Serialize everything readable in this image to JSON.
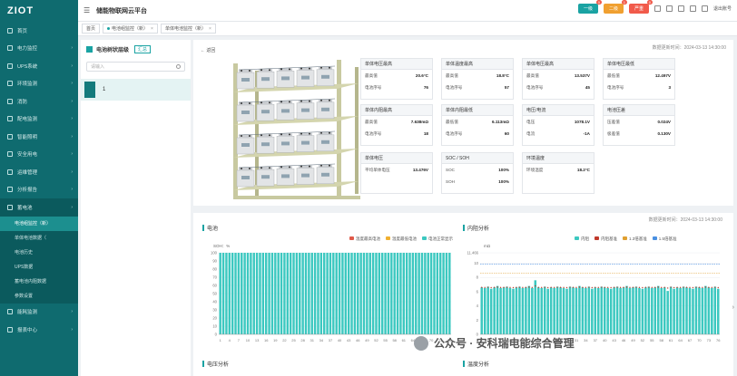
{
  "app": {
    "logo": "ZIOT",
    "title": "储能物联网云平台"
  },
  "header": {
    "badges": [
      {
        "label": "一级",
        "count": "0",
        "color": "#1aa3a3"
      },
      {
        "label": "二级",
        "count": "1",
        "color": "#f0a030"
      },
      {
        "label": "严重",
        "count": "0",
        "color": "#f15a4a"
      }
    ],
    "user": "退出账号"
  },
  "sidebar": {
    "items": [
      {
        "label": "首页"
      },
      {
        "label": "电力监控"
      },
      {
        "label": "UPS系统"
      },
      {
        "label": "环境监测"
      },
      {
        "label": "消防"
      },
      {
        "label": "配电监测"
      },
      {
        "label": "智能照明"
      },
      {
        "label": "安全用电"
      },
      {
        "label": "运维管理"
      },
      {
        "label": "分析报告"
      },
      {
        "label": "蓄电池"
      }
    ],
    "subitems": [
      {
        "label": "电池组监控（新）"
      },
      {
        "label": "单体电池数据（"
      },
      {
        "label": "电池历史"
      },
      {
        "label": "UPS数据"
      },
      {
        "label": "蓄电池内阻数据"
      },
      {
        "label": "参数设置"
      }
    ],
    "bottom": [
      {
        "label": "能耗监测"
      },
      {
        "label": "报表中心"
      }
    ]
  },
  "tabs": [
    {
      "label": "首页"
    },
    {
      "label": "电池组监控（新）"
    },
    {
      "label": "单体电池监控（新）"
    }
  ],
  "tree": {
    "title": "电池树状层级",
    "badge": "汇总",
    "search_placeholder": "请输入",
    "node": "1"
  },
  "main": {
    "back": "返回",
    "update": "数据更新时间：2024-03-13 14:30:00",
    "cards": [
      {
        "title": "单体电压最高",
        "rows": [
          {
            "k": "最高值",
            "v": "20.6°C"
          },
          {
            "k": "电池序号",
            "v": "76"
          }
        ]
      },
      {
        "title": "单体温度最高",
        "rows": [
          {
            "k": "最高值",
            "v": "18.8°C"
          },
          {
            "k": "电池序号",
            "v": "57"
          }
        ]
      },
      {
        "title": "单体电压最高",
        "rows": [
          {
            "k": "最高值",
            "v": "13.537V"
          },
          {
            "k": "电池序号",
            "v": "45"
          }
        ]
      },
      {
        "title": "单体电压最低",
        "rows": [
          {
            "k": "最低值",
            "v": "12.497V"
          },
          {
            "k": "电池序号",
            "v": "3"
          }
        ]
      },
      {
        "title": "单体内阻最高",
        "rows": [
          {
            "k": "最高值",
            "v": "7.638mΩ"
          },
          {
            "k": "电池序号",
            "v": "18"
          }
        ]
      },
      {
        "title": "单体内阻最低",
        "rows": [
          {
            "k": "最低值",
            "v": "6.113mΩ"
          },
          {
            "k": "电池序号",
            "v": "60"
          }
        ]
      },
      {
        "title": "电压/电流",
        "rows": [
          {
            "k": "电压",
            "v": "1078.1V"
          },
          {
            "k": "电流",
            "v": "-1A"
          }
        ]
      },
      {
        "title": "电池压差",
        "rows": [
          {
            "k": "压差值",
            "v": "0.024V"
          },
          {
            "k": "极差值",
            "v": "0.130V"
          }
        ]
      },
      {
        "title": "单体电压",
        "rows": [
          {
            "k": "平均单体电压",
            "v": "13.476V"
          }
        ]
      },
      {
        "title": "SOC / SOH",
        "rows": [
          {
            "k": "SOC",
            "v": "100%"
          },
          {
            "k": "SOH",
            "v": "100%"
          }
        ]
      },
      {
        "title": "环境温度",
        "rows": [
          {
            "k": "环境温度",
            "v": "18.2°C"
          }
        ]
      }
    ]
  },
  "charts_header": {
    "report_time": "数据更新时间：2024-03-13 14:30:00"
  },
  "chart_data": [
    {
      "type": "bar",
      "title": "电池",
      "ylabel": "SOH：%",
      "ylim": [
        0,
        100
      ],
      "yticks": [
        0,
        10,
        20,
        30,
        40,
        50,
        60,
        70,
        80,
        90,
        100
      ],
      "legend": [
        {
          "name": "温度最高电池",
          "color": "#e05a4a"
        },
        {
          "name": "温度最低电池",
          "color": "#f0b030"
        },
        {
          "name": "电池正常显示",
          "color": "#3cc8c0"
        }
      ],
      "categories_count": 76,
      "xticks": [
        "1",
        "4",
        "7",
        "10",
        "13",
        "16",
        "19",
        "22",
        "25",
        "28",
        "31",
        "34",
        "37",
        "40",
        "43",
        "46",
        "49",
        "52",
        "55",
        "58",
        "61",
        "64",
        "67",
        "70",
        "73",
        "76"
      ],
      "values": [
        100,
        100,
        100,
        100,
        100,
        100,
        100,
        100,
        100,
        100,
        100,
        100,
        100,
        100,
        100,
        100,
        100,
        100,
        100,
        100,
        100,
        100,
        100,
        100,
        100,
        100,
        100,
        100,
        100,
        100,
        100,
        100,
        100,
        100,
        100,
        100,
        100,
        100,
        100,
        100,
        100,
        100,
        100,
        100,
        100,
        100,
        100,
        100,
        100,
        100,
        100,
        100,
        100,
        100,
        100,
        100,
        100,
        100,
        100,
        100,
        100,
        100,
        100,
        100,
        100,
        100,
        100,
        100,
        100,
        100,
        100,
        100,
        100,
        100,
        100,
        100
      ]
    },
    {
      "type": "bar",
      "title": "内阻分析",
      "ylabel": "mΩ",
      "ylim": [
        0,
        11.466
      ],
      "yticks": [
        0,
        2,
        4,
        6,
        8,
        10,
        11.466
      ],
      "legend": [
        {
          "name": "内阻",
          "color": "#3cc8c0"
        },
        {
          "name": "内阻基准",
          "color": "#c0392b"
        },
        {
          "name": "1.3倍基准",
          "color": "#e0a030"
        },
        {
          "name": "1.5倍基准",
          "color": "#4a90e2"
        }
      ],
      "categories_count": 76,
      "xticks": [
        "1",
        "4",
        "7",
        "10",
        "13",
        "16",
        "19",
        "22",
        "25",
        "28",
        "31",
        "34",
        "37",
        "40",
        "43",
        "46",
        "49",
        "52",
        "55",
        "58",
        "61",
        "64",
        "67",
        "70",
        "73",
        "76"
      ],
      "values": [
        6.6,
        6.5,
        6.7,
        6.4,
        6.6,
        6.8,
        6.5,
        6.6,
        6.7,
        6.5,
        6.4,
        6.6,
        6.7,
        6.5,
        6.6,
        6.8,
        6.5,
        7.6,
        6.6,
        6.5,
        6.7,
        6.4,
        6.6,
        6.5,
        6.7,
        6.6,
        6.5,
        6.4,
        6.7,
        6.6,
        6.5,
        6.8,
        6.6,
        6.5,
        6.7,
        6.4,
        6.6,
        6.5,
        6.7,
        6.6,
        6.5,
        6.4,
        6.6,
        6.7,
        6.5,
        6.6,
        6.8,
        6.5,
        6.6,
        6.7,
        6.5,
        6.4,
        6.6,
        6.7,
        6.5,
        6.6,
        6.8,
        6.5,
        6.6,
        6.1,
        6.7,
        6.4,
        6.6,
        6.5,
        6.7,
        6.6,
        6.5,
        6.4,
        6.7,
        6.6,
        6.5,
        6.8,
        6.6,
        6.5,
        6.7,
        6.4
      ],
      "reference_lines": {
        "baseline": 6.6,
        "x1_3": 8.6,
        "x1_5": 9.9
      }
    }
  ],
  "bottom_sections": {
    "left": "电压分析",
    "right": "温度分析"
  },
  "watermark": "公众号 · 安科瑞电能综合管理"
}
